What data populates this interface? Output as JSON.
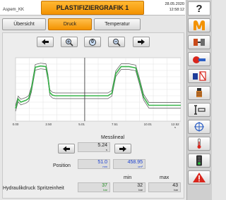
{
  "header": {
    "machine_name": "Aspem_KK",
    "title": "PLASTIFIZIERGRAFIK 1",
    "date": "28.05.2020",
    "time": "12:58:12"
  },
  "tabs": [
    {
      "label": "Übersicht",
      "active": false
    },
    {
      "label": "Druck",
      "active": true
    },
    {
      "label": "Temperatur",
      "active": false
    }
  ],
  "toolbar": {
    "icons": [
      "arrow-left-icon",
      "zoom-in-icon",
      "zoom-reset-icon",
      "zoom-out-icon",
      "arrow-right-icon"
    ],
    "reset_label": "0"
  },
  "chart_data": {
    "type": "line",
    "title": "",
    "xlabel": "",
    "ylabel": "",
    "x_tick_labels": [
      "0.00",
      "2.50",
      "5.01",
      "7.51",
      "10.01",
      "12.52"
    ],
    "x_unit": "s",
    "xlim": [
      0,
      12.52
    ],
    "ylim": [
      0,
      100
    ],
    "grid": true,
    "cursor_x": 5.24,
    "series": [
      {
        "color": "#39b54a",
        "x": [
          0,
          0.2,
          0.4,
          0.8,
          1.0,
          1.2,
          1.5,
          1.9,
          2.3,
          2.45,
          2.6,
          2.8,
          3.0,
          5.0,
          7.0,
          7.3,
          7.6,
          8.0,
          8.6,
          9.1,
          9.4,
          9.7,
          10.1,
          11.0,
          11.6,
          12.52
        ],
        "y": [
          20,
          35,
          30,
          33,
          36,
          50,
          85,
          87,
          86,
          70,
          45,
          41,
          40,
          40,
          40,
          44,
          75,
          86,
          86,
          84,
          62,
          38,
          25,
          25,
          25,
          25
        ]
      }
    ]
  },
  "measure": {
    "title": "Messlineal",
    "time_value": "5.24",
    "time_unit": "s"
  },
  "position": {
    "label": "Position",
    "value1": "51.0",
    "unit1": "mm",
    "value2": "458.95",
    "unit2": "cm³"
  },
  "hydraulic": {
    "label": "Hydraulikdruck Spritzeinheit",
    "min_label": "min",
    "max_label": "max",
    "current": "37",
    "min": "32",
    "max": "43",
    "unit": "bar"
  },
  "sidebar": {
    "help_label": "?",
    "items": [
      "machine-logo-icon",
      "mold-icon",
      "injection-unit-icon",
      "ejector-icon",
      "heating-icon",
      "core-pull-icon",
      "target-icon",
      "thermometer-icon",
      "traffic-light-icon",
      "warning-icon"
    ]
  },
  "colors": {
    "accent": "#f39200",
    "curve": "#39b54a",
    "value_blue": "#1a3fd0",
    "value_green": "#1e8a1e"
  }
}
